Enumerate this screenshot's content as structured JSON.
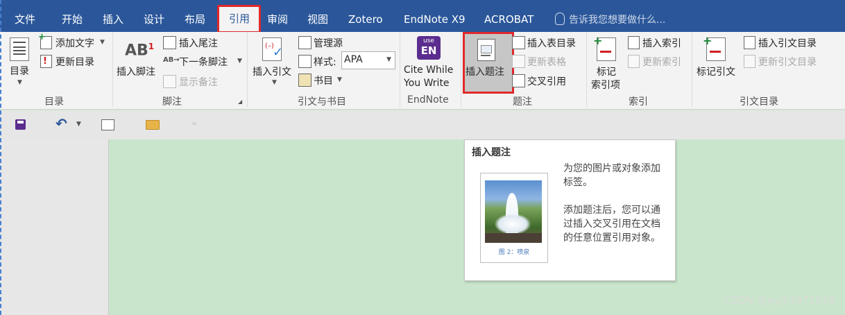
{
  "menu": {
    "tabs": [
      {
        "label": "文件"
      },
      {
        "label": "开始"
      },
      {
        "label": "插入"
      },
      {
        "label": "设计"
      },
      {
        "label": "布局"
      },
      {
        "label": "引用"
      },
      {
        "label": "审阅"
      },
      {
        "label": "视图"
      },
      {
        "label": "Zotero"
      },
      {
        "label": "EndNote X9"
      },
      {
        "label": "ACROBAT"
      }
    ],
    "active_tab": "引用",
    "tell_me": "告诉我您想要做什么..."
  },
  "ribbon": {
    "toc": {
      "toc_label": "目录",
      "add_text": "添加文字",
      "update_toc": "更新目录",
      "group": "目录"
    },
    "footnotes": {
      "insert_footnote": "插入脚注",
      "insert_endnote": "插入尾注",
      "next_footnote": "下一条脚注",
      "show_notes": "显示备注",
      "group": "脚注"
    },
    "citations": {
      "insert_citation": "插入引文",
      "manage_sources": "管理源",
      "style_label": "样式:",
      "style_value": "APA",
      "bibliography": "书目",
      "group": "引文与书目"
    },
    "endnote": {
      "cite_line1": "Cite While",
      "cite_line2": "You Write",
      "logo_line1": "use",
      "logo_line2": "EN",
      "group": "EndNote"
    },
    "captions": {
      "insert_caption": "插入题注",
      "insert_table_of_figures": "插入表目录",
      "update_table": "更新表格",
      "cross_reference": "交叉引用",
      "group": "题注"
    },
    "index": {
      "mark_entry_1": "标记",
      "mark_entry_2": "索引项",
      "insert_index": "插入索引",
      "update_index": "更新索引",
      "group": "索引"
    },
    "toa": {
      "mark_citation": "标记引文",
      "insert_toa": "插入引文目录",
      "update_toa": "更新引文目录",
      "group": "引文目录"
    }
  },
  "tooltip": {
    "title": "插入题注",
    "desc1_line1": "为您的图片或对象添加",
    "desc1_line2": "标签。",
    "desc2_line1": "添加题注后，您可以通",
    "desc2_line2": "过插入交叉引用在文档",
    "desc2_line3": "的任意位置引用对象。",
    "figure_caption": "图 2：喷泉"
  },
  "watermark": "CSDN @xyj19971018",
  "colors": {
    "ribbon_blue": "#2b579a",
    "highlight_red": "#e0282b",
    "doc_green": "#c9e6cc",
    "endnote_purple": "#5b2d8e"
  }
}
